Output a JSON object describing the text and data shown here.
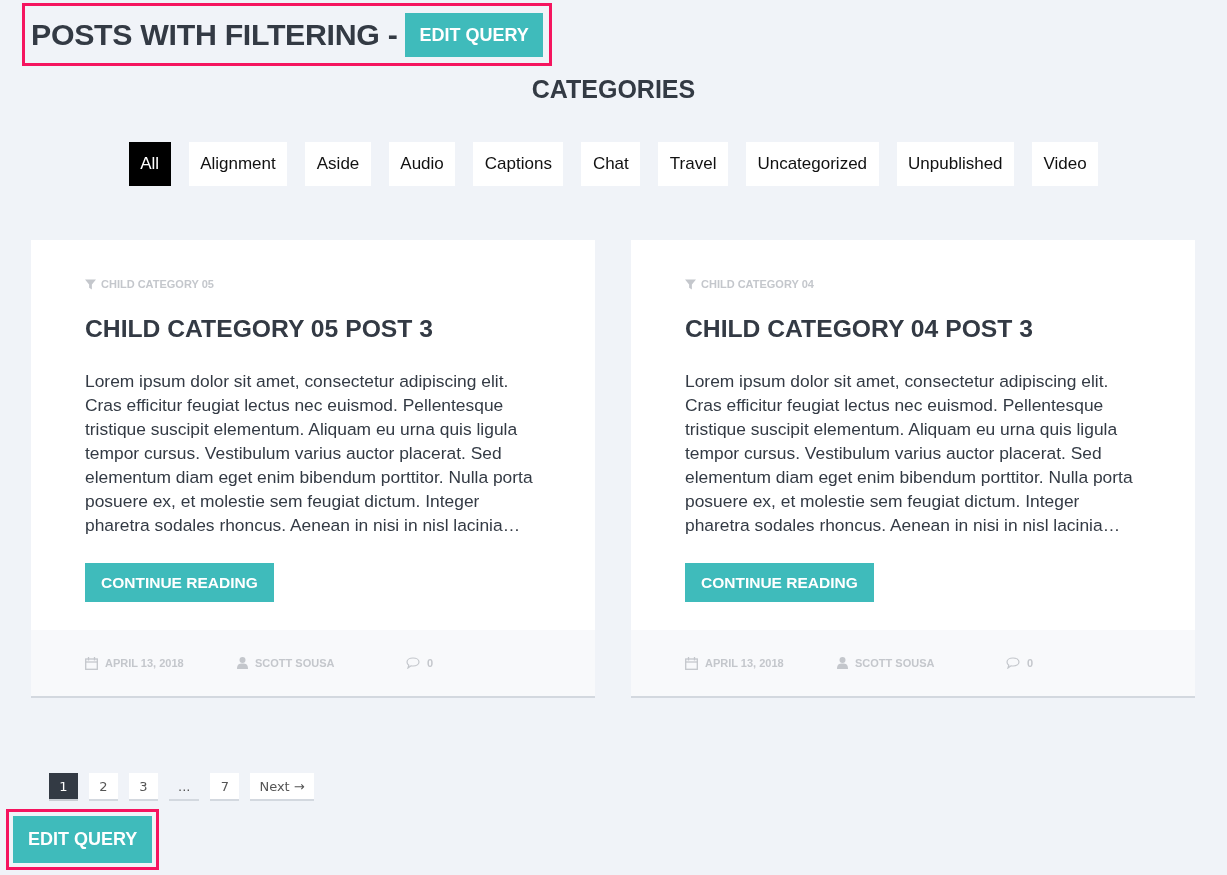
{
  "header": {
    "title": "POSTS WITH FILTERING -",
    "button": "EDIT QUERY",
    "highlighted": true
  },
  "categories": {
    "title": "CATEGORIES",
    "filters": [
      {
        "label": "All",
        "selected": true
      },
      {
        "label": "Alignment",
        "selected": false
      },
      {
        "label": "Aside",
        "selected": false
      },
      {
        "label": "Audio",
        "selected": false
      },
      {
        "label": "Captions",
        "selected": false
      },
      {
        "label": "Chat",
        "selected": false
      },
      {
        "label": "Travel",
        "selected": false
      },
      {
        "label": "Uncategorized",
        "selected": false
      },
      {
        "label": "Unpublished",
        "selected": false
      },
      {
        "label": "Video",
        "selected": false
      }
    ]
  },
  "posts": [
    {
      "category": "CHILD CATEGORY 05",
      "title": "CHILD CATEGORY 05 POST 3",
      "excerpt": "Lorem ipsum dolor sit amet, consectetur adipiscing elit. Cras efficitur feugiat lectus nec euismod. Pellentesque tristique suscipit elementum. Aliquam eu urna quis ligula tempor cursus. Vestibulum varius auctor placerat. Sed elementum diam eget enim bibendum porttitor. Nulla porta posuere ex, et molestie sem feugiat dictum. Integer pharetra sodales rhoncus. Aenean in nisi in nisl lacinia…",
      "button": "CONTINUE READING",
      "date": "APRIL 13, 2018",
      "author": "SCOTT SOUSA",
      "comments": "0"
    },
    {
      "category": "CHILD CATEGORY 04",
      "title": "CHILD CATEGORY 04 POST 3",
      "excerpt": "Lorem ipsum dolor sit amet, consectetur adipiscing elit. Cras efficitur feugiat lectus nec euismod. Pellentesque tristique suscipit elementum. Aliquam eu urna quis ligula tempor cursus. Vestibulum varius auctor placerat. Sed elementum diam eget enim bibendum porttitor. Nulla porta posuere ex, et molestie sem feugiat dictum. Integer pharetra sodales rhoncus. Aenean in nisi in nisl lacinia…",
      "button": "CONTINUE READING",
      "date": "APRIL 13, 2018",
      "author": "SCOTT SOUSA",
      "comments": "0"
    }
  ],
  "pagination": [
    {
      "label": "1",
      "kind": "page",
      "selected": true
    },
    {
      "label": "2",
      "kind": "page",
      "selected": false
    },
    {
      "label": "3",
      "kind": "page",
      "selected": false
    },
    {
      "label": "...",
      "kind": "ellipsis",
      "selected": false
    },
    {
      "label": "7",
      "kind": "page",
      "selected": false
    },
    {
      "label": "Next →",
      "kind": "next",
      "selected": false
    }
  ],
  "footer_button": {
    "label": "EDIT QUERY",
    "highlighted": true
  }
}
